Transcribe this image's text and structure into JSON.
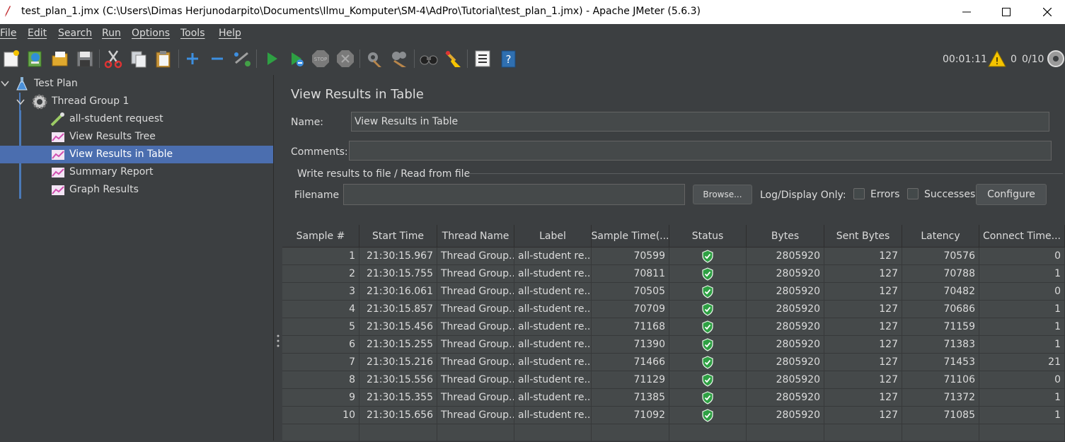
{
  "window": {
    "title": "test_plan_1.jmx (C:\\Users\\Dimas Herjunodarpito\\Documents\\Ilmu_Komputer\\SM-4\\AdPro\\Tutorial\\test_plan_1.jmx) - Apache JMeter (5.6.3)"
  },
  "menu": [
    "File",
    "Edit",
    "Search",
    "Run",
    "Options",
    "Tools",
    "Help"
  ],
  "toolbar": {
    "icons": [
      "new-icon",
      "templates-icon",
      "open-icon",
      "save-icon",
      "cut-icon",
      "copy-icon",
      "paste-icon",
      "expand-icon",
      "collapse-icon",
      "toggle-icon",
      "start-icon",
      "start-no-pause-icon",
      "stop-icon",
      "shutdown-icon",
      "clear-icon",
      "clear-all-icon",
      "search-icon",
      "reset-search-icon",
      "function-helper-icon",
      "help-icon"
    ],
    "elapsed": "00:01:11",
    "warnings": "0",
    "threads": "0/10"
  },
  "tree": {
    "items": [
      {
        "label": "Test Plan"
      },
      {
        "label": "Thread Group 1"
      },
      {
        "label": "all-student request"
      },
      {
        "label": "View Results Tree"
      },
      {
        "label": "View Results in Table"
      },
      {
        "label": "Summary Report"
      },
      {
        "label": "Graph Results"
      }
    ]
  },
  "panel": {
    "title": "View Results in Table",
    "name_label": "Name:",
    "name_value": "View Results in Table",
    "comments_label": "Comments:",
    "comments_value": "",
    "group_title": "Write results to file / Read from file",
    "filename_label": "Filename",
    "filename_value": "",
    "browse_label": "Browse...",
    "log_display_label": "Log/Display Only:",
    "errors_label": "Errors",
    "successes_label": "Successes",
    "configure_label": "Configure"
  },
  "table": {
    "columns": [
      "Sample #",
      "Start Time",
      "Thread Name",
      "Label",
      "Sample Time(...",
      "Status",
      "Bytes",
      "Sent Bytes",
      "Latency",
      "Connect Time..."
    ],
    "rows": [
      [
        "1",
        "21:30:15.967",
        "Thread Group...",
        "all-student re...",
        "70599",
        "success",
        "2805920",
        "127",
        "70576",
        "0"
      ],
      [
        "2",
        "21:30:15.755",
        "Thread Group...",
        "all-student re...",
        "70811",
        "success",
        "2805920",
        "127",
        "70788",
        "1"
      ],
      [
        "3",
        "21:30:16.061",
        "Thread Group...",
        "all-student re...",
        "70505",
        "success",
        "2805920",
        "127",
        "70482",
        "0"
      ],
      [
        "4",
        "21:30:15.857",
        "Thread Group...",
        "all-student re...",
        "70709",
        "success",
        "2805920",
        "127",
        "70686",
        "1"
      ],
      [
        "5",
        "21:30:15.456",
        "Thread Group...",
        "all-student re...",
        "71168",
        "success",
        "2805920",
        "127",
        "71159",
        "1"
      ],
      [
        "6",
        "21:30:15.255",
        "Thread Group...",
        "all-student re...",
        "71390",
        "success",
        "2805920",
        "127",
        "71383",
        "1"
      ],
      [
        "7",
        "21:30:15.216",
        "Thread Group...",
        "all-student re...",
        "71466",
        "success",
        "2805920",
        "127",
        "71453",
        "21"
      ],
      [
        "8",
        "21:30:15.556",
        "Thread Group...",
        "all-student re...",
        "71129",
        "success",
        "2805920",
        "127",
        "71106",
        "0"
      ],
      [
        "9",
        "21:30:15.355",
        "Thread Group...",
        "all-student re...",
        "71385",
        "success",
        "2805920",
        "127",
        "71372",
        "1"
      ],
      [
        "10",
        "21:30:15.656",
        "Thread Group...",
        "all-student re...",
        "71092",
        "success",
        "2805920",
        "127",
        "71085",
        "1"
      ]
    ]
  }
}
